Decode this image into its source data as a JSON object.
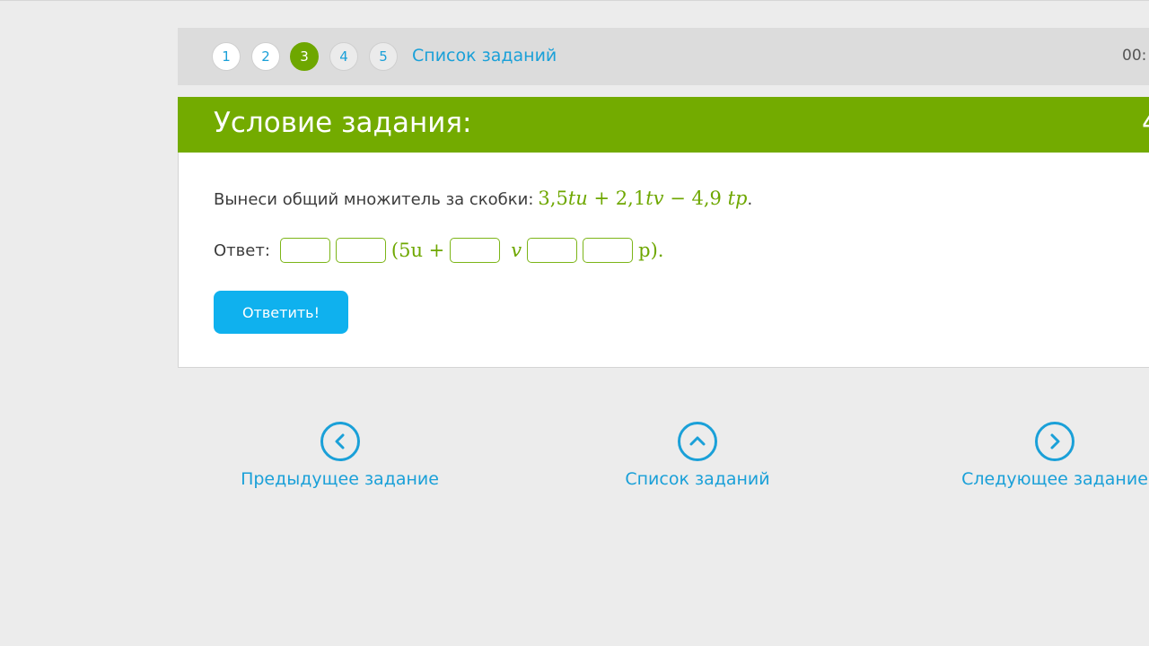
{
  "nav": {
    "steps": [
      "1",
      "2",
      "3",
      "4",
      "5"
    ],
    "active_step": "3",
    "task_list_link": "Список заданий",
    "timer": "00:"
  },
  "header": {
    "title": "Условие задания:",
    "number_fragment": "4"
  },
  "task": {
    "statement_text": "Вынеси общий множитель за скобки:",
    "expression": {
      "t1_coef": "3,5",
      "t1_vars": "tu",
      "op1": "+",
      "t2_coef": "2,1",
      "t2_vars": "tv",
      "op2": "−",
      "t3_coef": "4,9",
      "t3_vars": "tp",
      "end": "."
    },
    "answer_label": "Ответ:",
    "answer": {
      "open_paren_term": "(5u +",
      "var_v": "v",
      "close_term": "p).",
      "inputs": [
        "",
        "",
        "",
        "",
        ""
      ]
    },
    "submit_label": "Ответить!"
  },
  "bottom_nav": {
    "prev_label": "Предыдущее задание",
    "list_label": "Список заданий",
    "next_label": "Следующее задание"
  },
  "colors": {
    "accent_green": "#73ab00",
    "link_blue": "#1aa0d8",
    "button_blue": "#0fb1ee",
    "page_bg": "#ececec"
  }
}
